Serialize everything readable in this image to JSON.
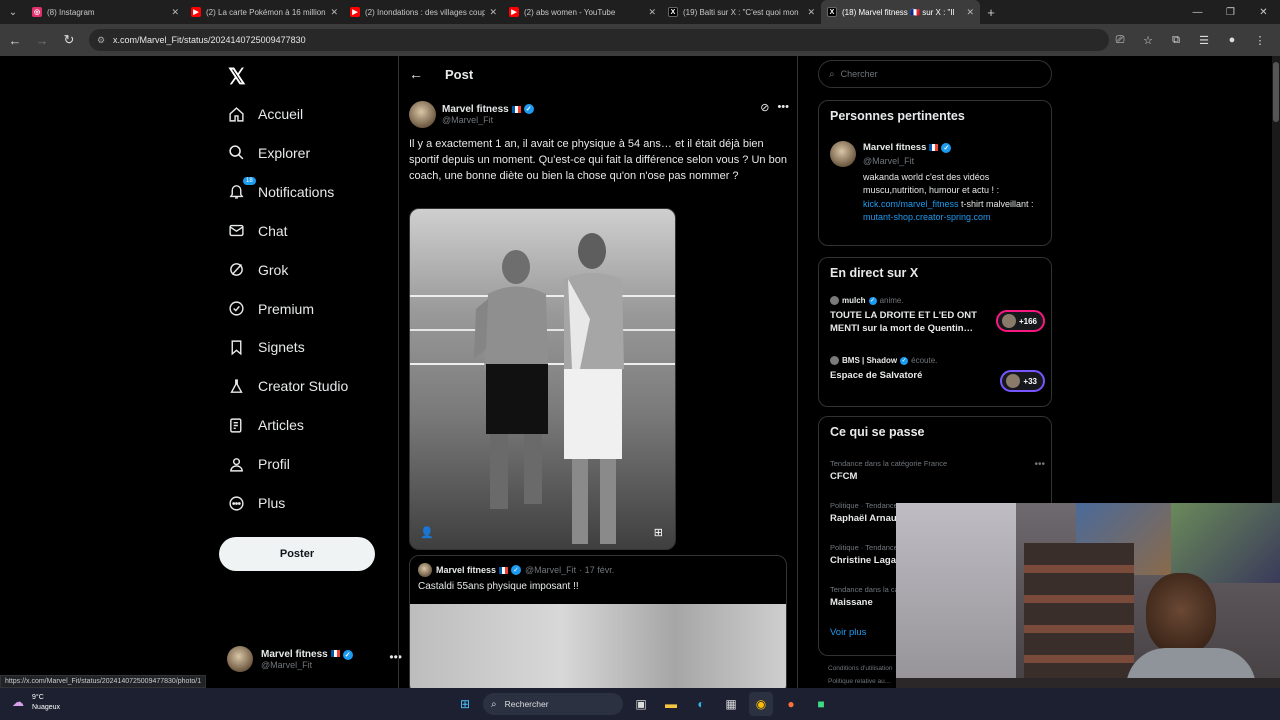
{
  "browser": {
    "tabs": [
      {
        "label": "(8) Instagram",
        "color": "#e1306c",
        "glyph": "◎"
      },
      {
        "label": "(2) La carte Pokémon à 16 millions",
        "color": "#ff0000",
        "glyph": "▶"
      },
      {
        "label": "(2) Inondations : des villages coupés",
        "color": "#ff0000",
        "glyph": "▶"
      },
      {
        "label": "(2) abs women - YouTube",
        "color": "#ff0000",
        "glyph": "▶"
      },
      {
        "label": "(19) Balti sur X : \"C'est quoi mon",
        "color": "#000000",
        "glyph": "X"
      },
      {
        "label": "(18) Marvel fitness 🇫🇷 sur X : \"Il",
        "color": "#000000",
        "glyph": "X"
      }
    ],
    "active_tab_index": 5,
    "url": "x.com/Marvel_Fit/status/2024140725009477830"
  },
  "sidebar": {
    "items": [
      {
        "label": "Accueil",
        "icon": "home-icon"
      },
      {
        "label": "Explorer",
        "icon": "search-icon"
      },
      {
        "label": "Notifications",
        "icon": "bell-icon",
        "badge": "18"
      },
      {
        "label": "Chat",
        "icon": "mail-icon"
      },
      {
        "label": "Grok",
        "icon": "grok-icon"
      },
      {
        "label": "Premium",
        "icon": "premium-icon"
      },
      {
        "label": "Signets",
        "icon": "bookmark-icon"
      },
      {
        "label": "Creator Studio",
        "icon": "flask-icon"
      },
      {
        "label": "Articles",
        "icon": "article-icon"
      },
      {
        "label": "Profil",
        "icon": "user-icon"
      },
      {
        "label": "Plus",
        "icon": "more-circle-icon"
      }
    ],
    "post_button": "Poster",
    "account": {
      "name": "Marvel fitness",
      "handle": "@Marvel_Fit"
    }
  },
  "status_url": "https://x.com/Marvel_Fit/status/2024140725009477830/photo/1",
  "post": {
    "header": "Post",
    "author": "Marvel fitness",
    "handle": "@Marvel_Fit",
    "text": "Il y a exactement 1 an, il avait ce physique à 54 ans… et il était déjà bien sportif depuis un moment. Qu'est-ce qui fait la différence selon vous ? Un bon coach, une bonne diète ou bien la chose qu'on n'ose pas nommer ?",
    "quote": {
      "author": "Marvel fitness",
      "handle": "@Marvel_Fit",
      "date": "· 17 févr.",
      "text": "Castaldi 55ans physique imposant !!"
    }
  },
  "right": {
    "search_placeholder": "Chercher",
    "relevant": {
      "title": "Personnes pertinentes",
      "name": "Marvel fitness",
      "handle": "@Marvel_Fit",
      "bio_text1": "wakanda world c'est des vidéos muscu,nutrition, humour et actu ! : ",
      "bio_link1": "kick.com/marvel_fitness",
      "bio_text2": " t-shirt malveillant : ",
      "bio_link2": "mutant-shop.creator-spring.com"
    },
    "live": {
      "title": "En direct sur X",
      "items": [
        {
          "host": "mulch",
          "action": "anime.",
          "title": "TOUTE LA DROITE ET L'ED ONT MENTI sur la mort de Quentin…",
          "count": "+166",
          "border": "#f91880"
        },
        {
          "host": "BMS | Shadow",
          "action": "écoute.",
          "title": "Espace de Salvatoré",
          "count": "+33",
          "border": "#7856ff"
        }
      ]
    },
    "trends": {
      "title": "Ce qui se passe",
      "items": [
        {
          "category": "Tendance dans la catégorie France",
          "name": "CFCM"
        },
        {
          "category": "Politique · Tendances",
          "name": "Raphaël Arnault"
        },
        {
          "category": "Politique · Tendances",
          "name": "Christine Lagarde"
        },
        {
          "category": "Tendance dans la catégorie France",
          "name": "Maissane"
        }
      ],
      "see_more": "Voir plus"
    },
    "footer": [
      "Conditions d'utilisation",
      "Politique relative au…"
    ]
  },
  "taskbar": {
    "temp": "9°C",
    "weather": "Nuageux",
    "search_placeholder": "Rechercher"
  }
}
